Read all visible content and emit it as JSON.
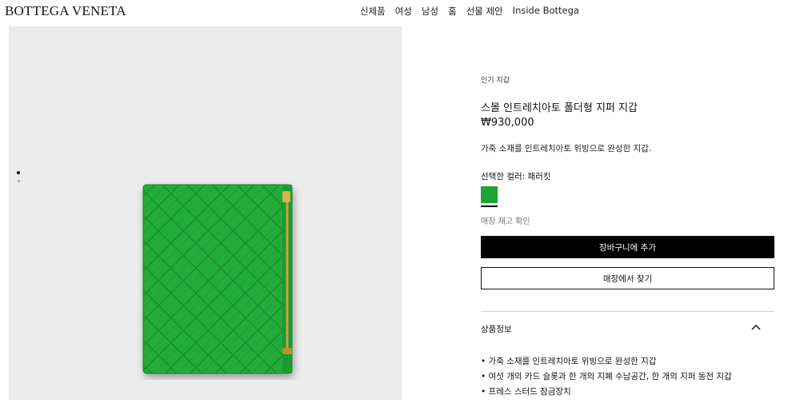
{
  "header": {
    "logo": "BOTTEGA VENETA",
    "nav": [
      "신제품",
      "여성",
      "남성",
      "홈",
      "선물 제안",
      "Inside Bottega"
    ]
  },
  "gallery": {
    "image_name": "green-intrecciato-wallet",
    "slide_count": 2,
    "active_slide": 1
  },
  "product": {
    "eyebrow": "인기 지갑",
    "title": "스몰 인트레치아토 폴더형 지퍼 지갑",
    "price": "₩930,000",
    "description": "가죽 소재를 인트레치아토 위빙으로 완성한 지갑.",
    "selected_color_label": "선택한 컬러: 패러킷",
    "swatch_color": "#1ea235",
    "stock_check": "매장 재고 확인",
    "add_to_cart": "장바구니에 추가",
    "find_in_store": "매장에서 찾기"
  },
  "details": {
    "title": "상품정보",
    "expanded": true,
    "bullets": [
      "• 가죽 소재를 인트레치아토 위빙으로 완성한 지갑",
      "• 여섯 개의 카드 슬롯과 한 개의 지폐 수납공간, 한 개의 지퍼 동전 지갑",
      "• 프레스 스터드 잠금장치"
    ]
  },
  "colors": {
    "wallet_green": "#1ea235",
    "gallery_bg": "#ebebeb",
    "zipper_gold": "#c9a440"
  }
}
